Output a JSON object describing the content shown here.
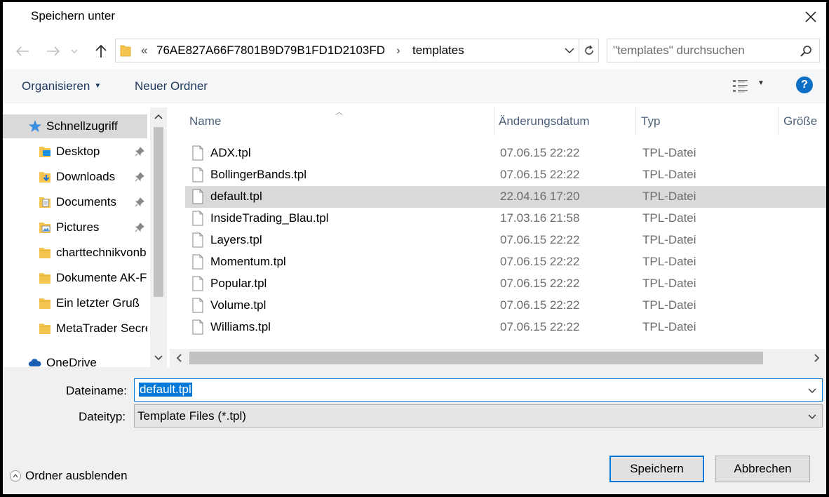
{
  "window": {
    "title": "Speichern unter"
  },
  "address": {
    "segment_parent": "76AE827A66F7801B9D79B1FD1D2103FD",
    "segment_current": "templates",
    "overflow_chevron": "«",
    "separator": "›"
  },
  "search": {
    "placeholder": "\"templates\" durchsuchen"
  },
  "toolbar": {
    "organize_label": "Organisieren",
    "new_folder_label": "Neuer Ordner",
    "help_label": "?"
  },
  "nav": {
    "items": [
      {
        "label": "Schnellzugriff",
        "icon": "star-icon"
      },
      {
        "label": "Desktop",
        "icon": "desktop-folder-icon",
        "pinned": true
      },
      {
        "label": "Downloads",
        "icon": "downloads-folder-icon",
        "pinned": true
      },
      {
        "label": "Documents",
        "icon": "documents-folder-icon",
        "pinned": true
      },
      {
        "label": "Pictures",
        "icon": "pictures-folder-icon",
        "pinned": true
      },
      {
        "label": "charttechnikvonb",
        "icon": "folder-icon"
      },
      {
        "label": "Dokumente AK-F",
        "icon": "folder-icon"
      },
      {
        "label": "Ein letzter Gruß",
        "icon": "folder-icon"
      },
      {
        "label": "MetaTrader Secre",
        "icon": "folder-icon"
      },
      {
        "label": "OneDrive",
        "icon": "cloud-icon"
      }
    ]
  },
  "columns": {
    "name": "Name",
    "date": "Änderungsdatum",
    "type": "Typ",
    "size": "Größe"
  },
  "files": [
    {
      "name": "ADX.tpl",
      "date": "07.06.15 22:22",
      "type": "TPL-Datei"
    },
    {
      "name": "BollingerBands.tpl",
      "date": "07.06.15 22:22",
      "type": "TPL-Datei"
    },
    {
      "name": "default.tpl",
      "date": "22.04.16 17:20",
      "type": "TPL-Datei"
    },
    {
      "name": "InsideTrading_Blau.tpl",
      "date": "17.03.16 21:58",
      "type": "TPL-Datei"
    },
    {
      "name": "Layers.tpl",
      "date": "07.06.15 22:22",
      "type": "TPL-Datei"
    },
    {
      "name": "Momentum.tpl",
      "date": "07.06.15 22:22",
      "type": "TPL-Datei"
    },
    {
      "name": "Popular.tpl",
      "date": "07.06.15 22:22",
      "type": "TPL-Datei"
    },
    {
      "name": "Volume.tpl",
      "date": "07.06.15 22:22",
      "type": "TPL-Datei"
    },
    {
      "name": "Williams.tpl",
      "date": "07.06.15 22:22",
      "type": "TPL-Datei"
    }
  ],
  "selected_file": "default.tpl",
  "form": {
    "filename_label": "Dateiname:",
    "filename_value": "default.tpl",
    "filetype_label": "Dateityp:",
    "filetype_value": "Template Files (*.tpl)"
  },
  "footer": {
    "hide_folders_label": "Ordner ausblenden",
    "save_label": "Speichern",
    "cancel_label": "Abbrechen"
  },
  "colors": {
    "accent": "#0078d7",
    "selection": "#d9d9d9",
    "folder": "#f4c44e"
  }
}
